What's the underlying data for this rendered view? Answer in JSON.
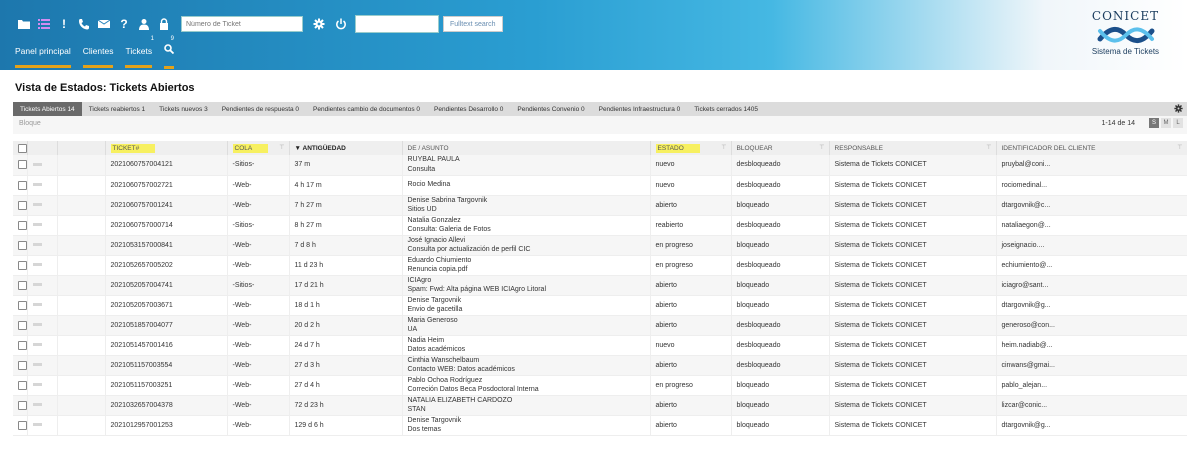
{
  "header": {
    "toolbar_icons": [
      {
        "name": "folder-icon",
        "count": ""
      },
      {
        "name": "list-icon",
        "count": ""
      },
      {
        "name": "exclamation-icon",
        "count": ""
      },
      {
        "name": "phone-icon",
        "count": ""
      },
      {
        "name": "envelope-icon",
        "count": ""
      },
      {
        "name": "question-icon",
        "count": ""
      },
      {
        "name": "user-icon",
        "count": "1"
      },
      {
        "name": "lock-icon",
        "count": "9"
      }
    ],
    "ticket_number_placeholder": "Número de Ticket",
    "fulltext_button": "Fulltext search"
  },
  "nav": {
    "items": [
      "Panel principal",
      "Clientes",
      "Tickets"
    ]
  },
  "logo": {
    "title": "CONICET",
    "subtitle": "Sistema de Tickets"
  },
  "page_title": "Vista de Estados: Tickets Abiertos",
  "tabs": [
    {
      "label": "Tickets Abiertos 14",
      "active": true
    },
    {
      "label": "Tickets reabiertos 1",
      "active": false
    },
    {
      "label": "Tickets nuevos 3",
      "active": false
    },
    {
      "label": "Pendientes de respuesta 0",
      "active": false
    },
    {
      "label": "Pendientes cambio de documentos 0",
      "active": false
    },
    {
      "label": "Pendientes Desarrollo 0",
      "active": false
    },
    {
      "label": "Pendientes Convenio 0",
      "active": false
    },
    {
      "label": "Pendientes Infraestructura 0",
      "active": false
    },
    {
      "label": "Tickets cerrados 1405",
      "active": false
    }
  ],
  "subbar": {
    "bloque": "Bloque",
    "pager": "1-14 de 14",
    "sizes": [
      {
        "label": "S",
        "active": true
      },
      {
        "label": "M",
        "active": false
      },
      {
        "label": "L",
        "active": false
      }
    ]
  },
  "table": {
    "headers": {
      "ticket": "TICKET#",
      "cola": "COLA",
      "antiguedad": "▼ ANTIGÜEDAD",
      "asunto": "DE / ASUNTO",
      "estado": "ESTADO",
      "bloquear": "BLOQUEAR",
      "responsable": "RESPONSABLE",
      "cliente": "IDENTIFICADOR DEL CLIENTE"
    },
    "rows": [
      {
        "ticket": "2021060757004121",
        "cola": "-Sitios-",
        "age": "37 m",
        "from": "RUYBAL PAULA",
        "subject": "Consulta",
        "estado": "nuevo",
        "lock": "desbloqueado",
        "owner": "Sistema de Tickets CONICET",
        "client": "pruybal@coni..."
      },
      {
        "ticket": "2021060757002721",
        "cola": "-Web-",
        "age": "4 h 17 m",
        "from": "Rocio Medina",
        "subject": "",
        "estado": "nuevo",
        "lock": "desbloqueado",
        "owner": "Sistema de Tickets CONICET",
        "client": "rociomedinal..."
      },
      {
        "ticket": "2021060757001241",
        "cola": "-Web-",
        "age": "7 h 27 m",
        "from": "Denise Sabrina Targovnik",
        "subject": "Sitios UD",
        "estado": "abierto",
        "lock": "bloqueado",
        "owner": "Sistema de Tickets CONICET",
        "client": "dtargovnik@c..."
      },
      {
        "ticket": "2021060757000714",
        "cola": "-Sitios-",
        "age": "8 h 27 m",
        "from": "Natalia Gonzalez",
        "subject": "Consulta: Galeria de Fotos",
        "estado": "reabierto",
        "lock": "desbloqueado",
        "owner": "Sistema de Tickets CONICET",
        "client": "nataliaegon@..."
      },
      {
        "ticket": "2021053157000841",
        "cola": "-Web-",
        "age": "7 d 8 h",
        "from": "José Ignacio Allevi",
        "subject": "Consulta por actualización de perfil CIC",
        "estado": "en progreso",
        "lock": "bloqueado",
        "owner": "Sistema de Tickets CONICET",
        "client": "joseignacio...."
      },
      {
        "ticket": "2021052657005202",
        "cola": "-Web-",
        "age": "11 d 23 h",
        "from": "Eduardo Chiumiento",
        "subject": "Renuncia copia.pdf",
        "estado": "en progreso",
        "lock": "desbloqueado",
        "owner": "Sistema de Tickets CONICET",
        "client": "echiumiento@..."
      },
      {
        "ticket": "2021052057004741",
        "cola": "-Sitios-",
        "age": "17 d 21 h",
        "from": "ICIAgro",
        "subject": "Spam: Fwd: Alta página WEB ICIAgro Litoral",
        "estado": "abierto",
        "lock": "bloqueado",
        "owner": "Sistema de Tickets CONICET",
        "client": "iciagro@sant..."
      },
      {
        "ticket": "2021052057003671",
        "cola": "-Web-",
        "age": "18 d 1 h",
        "from": "Denise Targovnik",
        "subject": "Envio de gacetilla",
        "estado": "abierto",
        "lock": "bloqueado",
        "owner": "Sistema de Tickets CONICET",
        "client": "dtargovnik@g..."
      },
      {
        "ticket": "2021051857004077",
        "cola": "-Web-",
        "age": "20 d 2 h",
        "from": "Maria Generoso",
        "subject": "UA",
        "estado": "abierto",
        "lock": "desbloqueado",
        "owner": "Sistema de Tickets CONICET",
        "client": "generoso@con..."
      },
      {
        "ticket": "2021051457001416",
        "cola": "-Web-",
        "age": "24 d 7 h",
        "from": "Nadia Heim",
        "subject": "Datos académicos",
        "estado": "nuevo",
        "lock": "desbloqueado",
        "owner": "Sistema de Tickets CONICET",
        "client": "heim.nadiab@..."
      },
      {
        "ticket": "2021051157003554",
        "cola": "-Web-",
        "age": "27 d 3 h",
        "from": "Cinthia Wanschelbaum",
        "subject": "Contacto WEB: Datos académicos",
        "estado": "abierto",
        "lock": "desbloqueado",
        "owner": "Sistema de Tickets CONICET",
        "client": "cinwans@gmai..."
      },
      {
        "ticket": "2021051157003251",
        "cola": "-Web-",
        "age": "27 d 4 h",
        "from": "Pablo Ochoa Rodríguez",
        "subject": "Correción Datos Beca Posdoctoral Interna",
        "estado": "en progreso",
        "lock": "bloqueado",
        "owner": "Sistema de Tickets CONICET",
        "client": "pablo_alejan..."
      },
      {
        "ticket": "2021032657004378",
        "cola": "-Web-",
        "age": "72 d 23 h",
        "from": "NATALIA ELIZABETH CARDOZO",
        "subject": "STAN",
        "estado": "abierto",
        "lock": "bloqueado",
        "owner": "Sistema de Tickets CONICET",
        "client": "lizcar@conic..."
      },
      {
        "ticket": "2021012957001253",
        "cola": "-Web-",
        "age": "129 d 6 h",
        "from": "Denise Targovnik",
        "subject": "Dos temas",
        "estado": "abierto",
        "lock": "bloqueado",
        "owner": "Sistema de Tickets CONICET",
        "client": "dtargovnik@g..."
      }
    ]
  }
}
